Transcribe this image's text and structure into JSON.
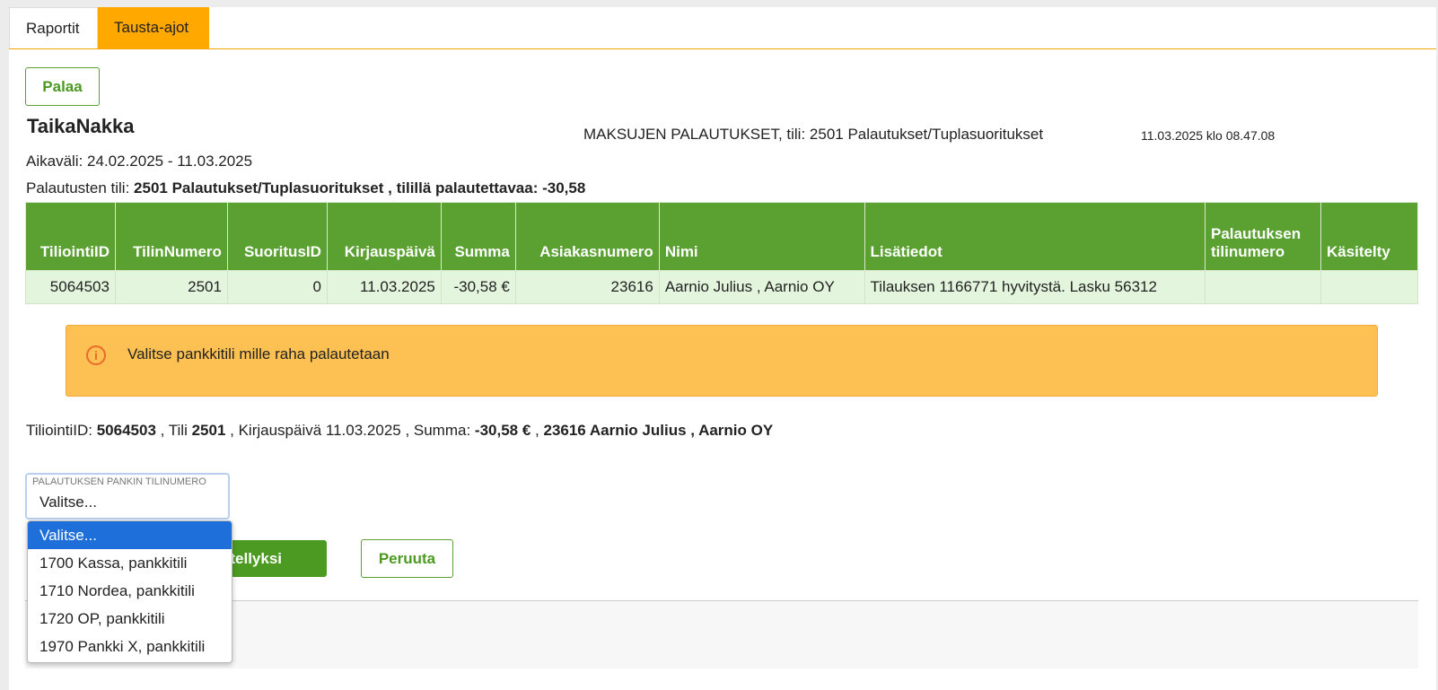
{
  "tabs": [
    {
      "label": "Raportit"
    },
    {
      "label": "Tausta-ajot"
    }
  ],
  "buttons": {
    "back": "Palaa",
    "confirm_partial": "ttellyksi",
    "cancel": "Peruuta"
  },
  "header": {
    "company": "TaikaNakka",
    "report_title": "MAKSUJEN PALAUTUKSET, tili: 2501 Palautukset/Tuplasuoritukset",
    "timestamp": "11.03.2025 klo 08.47.08",
    "aikavali_label": "Aikaväli:",
    "aikavali_value": "24.02.2025 - 11.03.2025",
    "tili_label": "Palautusten tili:",
    "tili_value": "2501 Palautukset/Tuplasuoritukset , tilillä palautettavaa: -30,58"
  },
  "table": {
    "columns": [
      "TiliointiID",
      "TilinNumero",
      "SuoritusID",
      "Kirjauspäivä",
      "Summa",
      "Asiakasnumero",
      "Nimi",
      "Lisätiedot",
      "Palautuksen tilinumero",
      "Käsitelty"
    ],
    "rows": [
      {
        "tiliointi_id": "5064503",
        "tilinumero": "2501",
        "suoritus_id": "0",
        "kirjauspaiva": "11.03.2025",
        "summa": "-30,58 €",
        "asiakasnumero": "23616",
        "nimi": "Aarnio Julius , Aarnio OY",
        "lisatiedot": "Tilauksen 1166771 hyvitystä. Lasku 56312",
        "palautuksen_tilinumero": "",
        "kasitelty": ""
      }
    ]
  },
  "alert": {
    "icon": "info-icon",
    "text": "Valitse pankkitili mille raha palautetaan"
  },
  "summary": {
    "t1": "TiliointiID: ",
    "b1": "5064503",
    "t2": " , Tili ",
    "b2": "2501",
    "t3": " , Kirjauspäivä 11.03.2025 , Summa: ",
    "b3": "-30,58 €",
    "t4": " , ",
    "b4": "23616 Aarnio Julius , Aarnio OY"
  },
  "select": {
    "label": "PALAUTUKSEN PANKIN TILINUMERO",
    "value": "Valitse...",
    "options": [
      "Valitse...",
      "1700 Kassa, pankkitili",
      "1710 Nordea, pankkitili",
      "1720 OP, pankkitili",
      "1970 Pankki X, pankkitili"
    ]
  },
  "colors": {
    "accent_green": "#5aa132",
    "tab_orange": "#ffa800",
    "alert_bg": "#fdc052",
    "selected_blue": "#1e6fd9"
  }
}
